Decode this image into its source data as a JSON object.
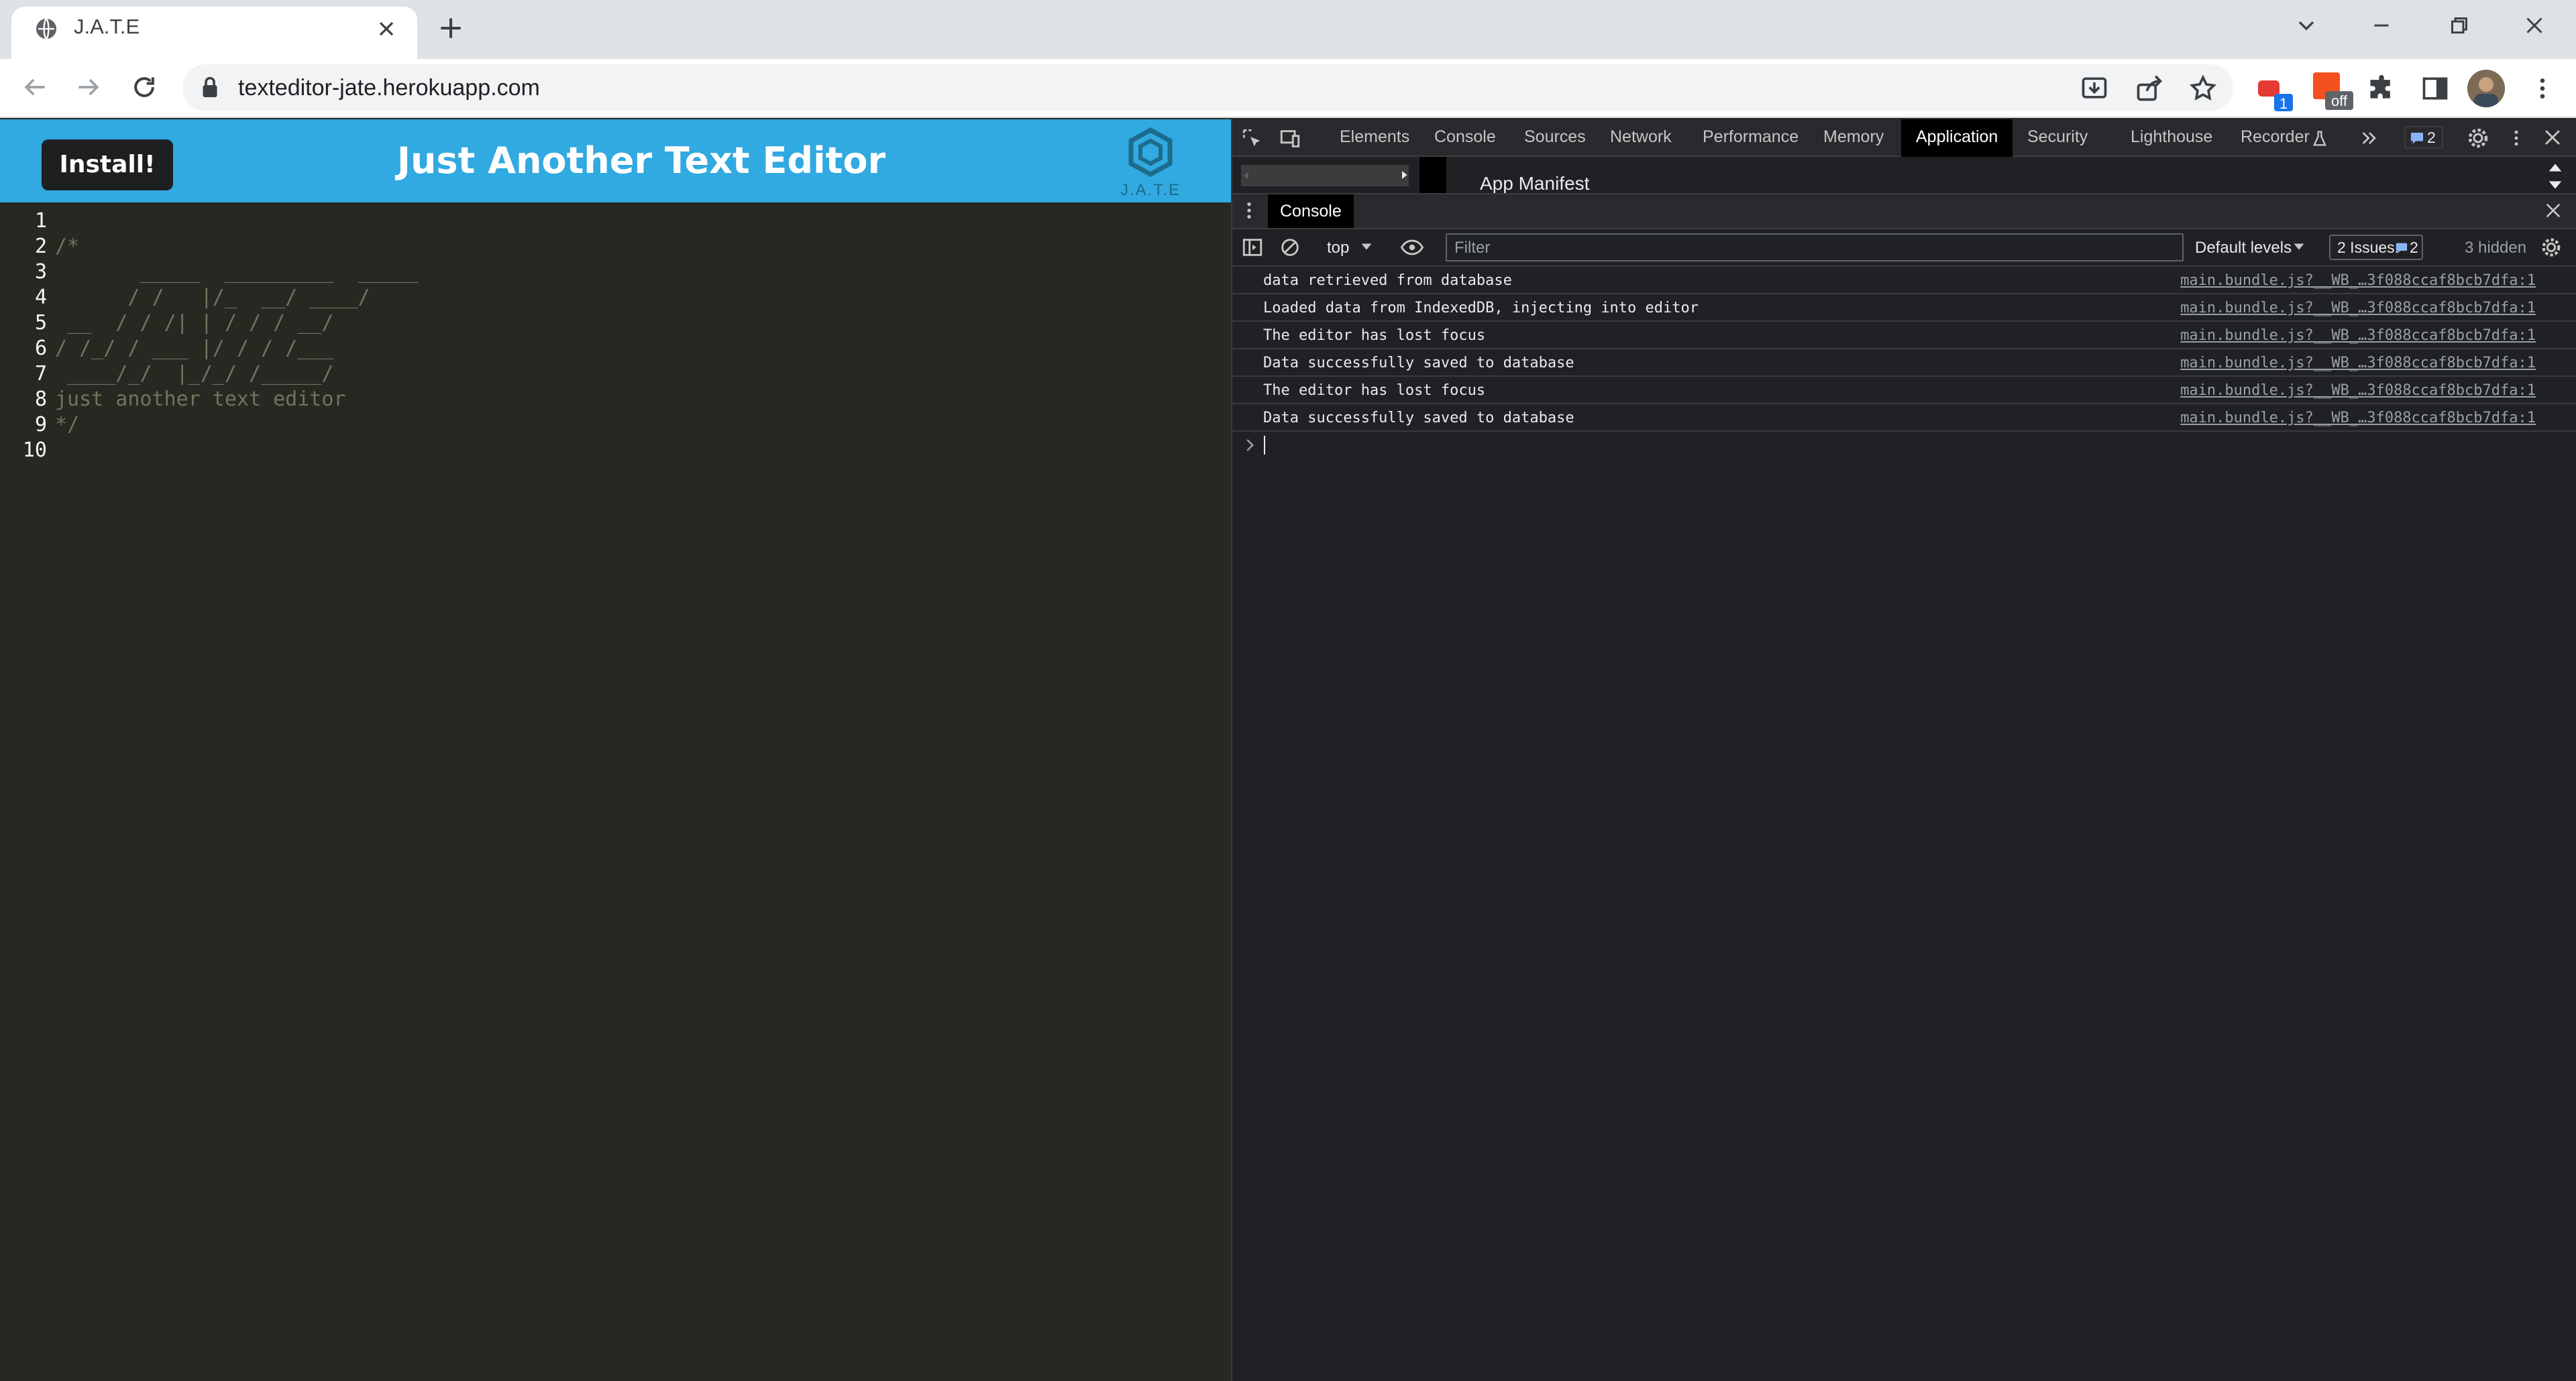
{
  "browser": {
    "tab_title": "J.A.T.E",
    "url": "texteditor-jate.herokuapp.com",
    "extension_badges": [
      "1",
      "off"
    ]
  },
  "app": {
    "install_label": "Install!",
    "title": "Just Another Text Editor",
    "logo_text": "J.A.T.E",
    "colors": {
      "navbar": "#31a9e1",
      "editor_bg": "#272822",
      "comment": "#75715e"
    }
  },
  "editor": {
    "line_numbers": [
      "1",
      "2",
      "3",
      "4",
      "5",
      "6",
      "7",
      "8",
      "9",
      "10"
    ],
    "lines": [
      "",
      "/*",
      "       _____  _________  _____",
      "      / /   |/_  __/ ____/",
      " __  / / /| | / / / __/",
      "/ /_/ / ___ |/ / / /___",
      " ____/_/  |_/_/ /_____/",
      "just another text editor",
      "*/",
      ""
    ]
  },
  "devtools": {
    "tabs": [
      "Elements",
      "Console",
      "Sources",
      "Network",
      "Performance",
      "Memory",
      "Application",
      "Security",
      "Lighthouse",
      "Recorder"
    ],
    "active_tab": "Application",
    "issues_badge_count": "2",
    "panel_heading": "App Manifest",
    "drawer_tab": "Console",
    "context": "top",
    "filter_placeholder": "Filter",
    "levels": "Default levels",
    "issues_label": "2 Issues:",
    "issues_count": "2",
    "hidden": "3 hidden",
    "logs": [
      {
        "message": "data retrieved from database",
        "source": "main.bundle.js?__WB_…3f088ccaf8bcb7dfa:1"
      },
      {
        "message": "Loaded data from IndexedDB, injecting into editor",
        "source": "main.bundle.js?__WB_…3f088ccaf8bcb7dfa:1"
      },
      {
        "message": "The editor has lost focus",
        "source": "main.bundle.js?__WB_…3f088ccaf8bcb7dfa:1"
      },
      {
        "message": "Data successfully saved to database",
        "source": "main.bundle.js?__WB_…3f088ccaf8bcb7dfa:1"
      },
      {
        "message": "The editor has lost focus",
        "source": "main.bundle.js?__WB_…3f088ccaf8bcb7dfa:1"
      },
      {
        "message": "Data successfully saved to database",
        "source": "main.bundle.js?__WB_…3f088ccaf8bcb7dfa:1"
      }
    ]
  }
}
